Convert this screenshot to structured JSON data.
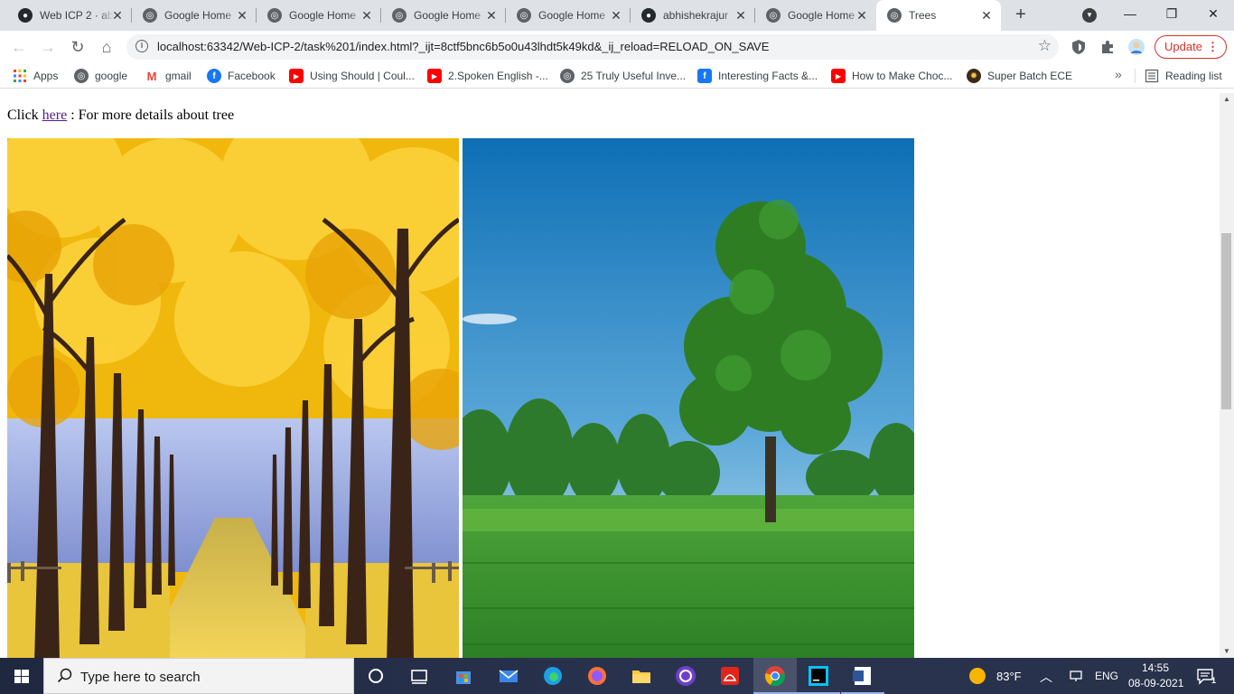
{
  "browser": {
    "tabs": [
      {
        "title": "Web ICP 2 · ab",
        "icon": "github-icon",
        "active": false
      },
      {
        "title": "Google Home",
        "icon": "globe-icon",
        "active": false
      },
      {
        "title": "Google Home",
        "icon": "globe-icon",
        "active": false
      },
      {
        "title": "Google Home",
        "icon": "globe-icon",
        "active": false
      },
      {
        "title": "Google Home",
        "icon": "globe-icon",
        "active": false
      },
      {
        "title": "abhishekrajur",
        "icon": "github-icon",
        "active": false
      },
      {
        "title": "Google Home",
        "icon": "globe-icon",
        "active": false
      },
      {
        "title": "Trees",
        "icon": "globe-icon",
        "active": true
      }
    ],
    "url": "localhost:63342/Web-ICP-2/task%201/index.html?_ijt=8ctf5bnc6b5o0u43lhdt5k49kd&_ij_reload=RELOAD_ON_SAVE",
    "update_label": "Update",
    "bookmarks": [
      {
        "label": "Apps",
        "icon": "apps-grid-icon"
      },
      {
        "label": "google",
        "icon": "globe-icon"
      },
      {
        "label": "gmail",
        "icon": "gmail-icon"
      },
      {
        "label": "Facebook",
        "icon": "facebook-icon"
      },
      {
        "label": "Using Should | Coul...",
        "icon": "youtube-icon"
      },
      {
        "label": "2.Spoken English -...",
        "icon": "youtube-icon"
      },
      {
        "label": "25 Truly Useful Inve...",
        "icon": "globe-icon"
      },
      {
        "label": "Interesting Facts &...",
        "icon": "facebook-square-icon"
      },
      {
        "label": "How to Make Choc...",
        "icon": "youtube-icon"
      },
      {
        "label": "Super Batch ECE",
        "icon": "batch-icon"
      }
    ],
    "reading_list_label": "Reading list",
    "more_bookmarks": "»"
  },
  "page": {
    "intro_prefix": "Click ",
    "intro_link": "here",
    "intro_suffix": " : For more details about tree",
    "images": [
      {
        "subject": "autumn-yellow-tree-avenue",
        "colors": [
          "#f2b90c",
          "#4a2e1d",
          "#8fa2d8"
        ]
      },
      {
        "subject": "green-tree-in-meadow",
        "colors": [
          "#1f7fc4",
          "#2f8f2a",
          "#3f9a32"
        ]
      }
    ]
  },
  "taskbar": {
    "search_placeholder": "Type here to search",
    "weather": "83°F",
    "language": "ENG",
    "time": "14:55",
    "date": "08-09-2021",
    "notification_count": "1"
  }
}
